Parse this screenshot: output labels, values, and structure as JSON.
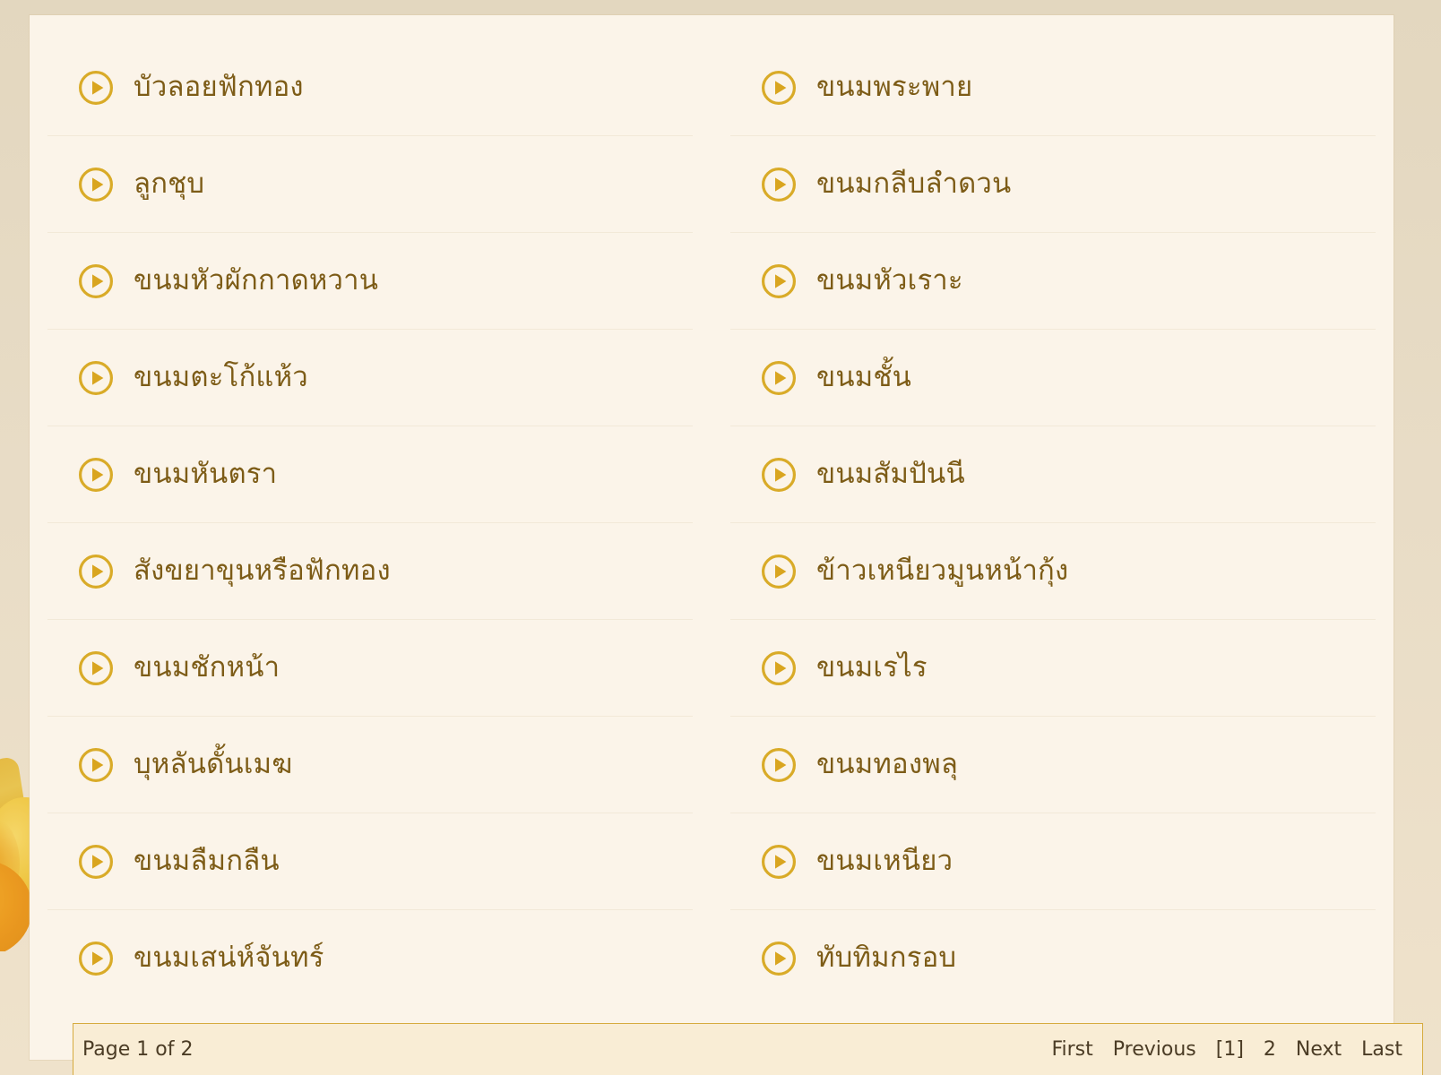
{
  "panel": {
    "accent_color": "#d4a424",
    "text_color": "#7d5c17",
    "panel_bg": "#fbf4e9",
    "page_bg": "#e6dac3"
  },
  "icons": {
    "play": "play-circle-icon"
  },
  "recipes": {
    "left_column": [
      {
        "label": "บัวลอยฟักทอง"
      },
      {
        "label": "ลูกชุบ"
      },
      {
        "label": "ขนมหัวผักกาดหวาน"
      },
      {
        "label": "ขนมตะโก้แห้ว"
      },
      {
        "label": "ขนมหันตรา"
      },
      {
        "label": "สังขยาขุนหรือฟักทอง"
      },
      {
        "label": "ขนมชักหน้า"
      },
      {
        "label": "บุหลันดั้นเมฆ"
      },
      {
        "label": "ขนมลืมกลืน"
      },
      {
        "label": "ขนมเสน่ห์จันทร์"
      }
    ],
    "right_column": [
      {
        "label": "ขนมพระพาย"
      },
      {
        "label": "ขนมกลีบลำดวน"
      },
      {
        "label": "ขนมหัวเราะ"
      },
      {
        "label": "ขนมชั้น"
      },
      {
        "label": "ขนมสัมปันนี"
      },
      {
        "label": "ข้าวเหนียวมูนหน้ากุ้ง"
      },
      {
        "label": "ขนมเรไร"
      },
      {
        "label": "ขนมทองพลุ"
      },
      {
        "label": "ขนมเหนียว"
      },
      {
        "label": "ทับทิมกรอบ"
      }
    ]
  },
  "pagination": {
    "status": "Page 1 of 2",
    "links": [
      {
        "label": "First",
        "current": false
      },
      {
        "label": "Previous",
        "current": false
      },
      {
        "label": "[1]",
        "current": true
      },
      {
        "label": "2",
        "current": false
      },
      {
        "label": "Next",
        "current": false
      },
      {
        "label": "Last",
        "current": false
      }
    ]
  }
}
